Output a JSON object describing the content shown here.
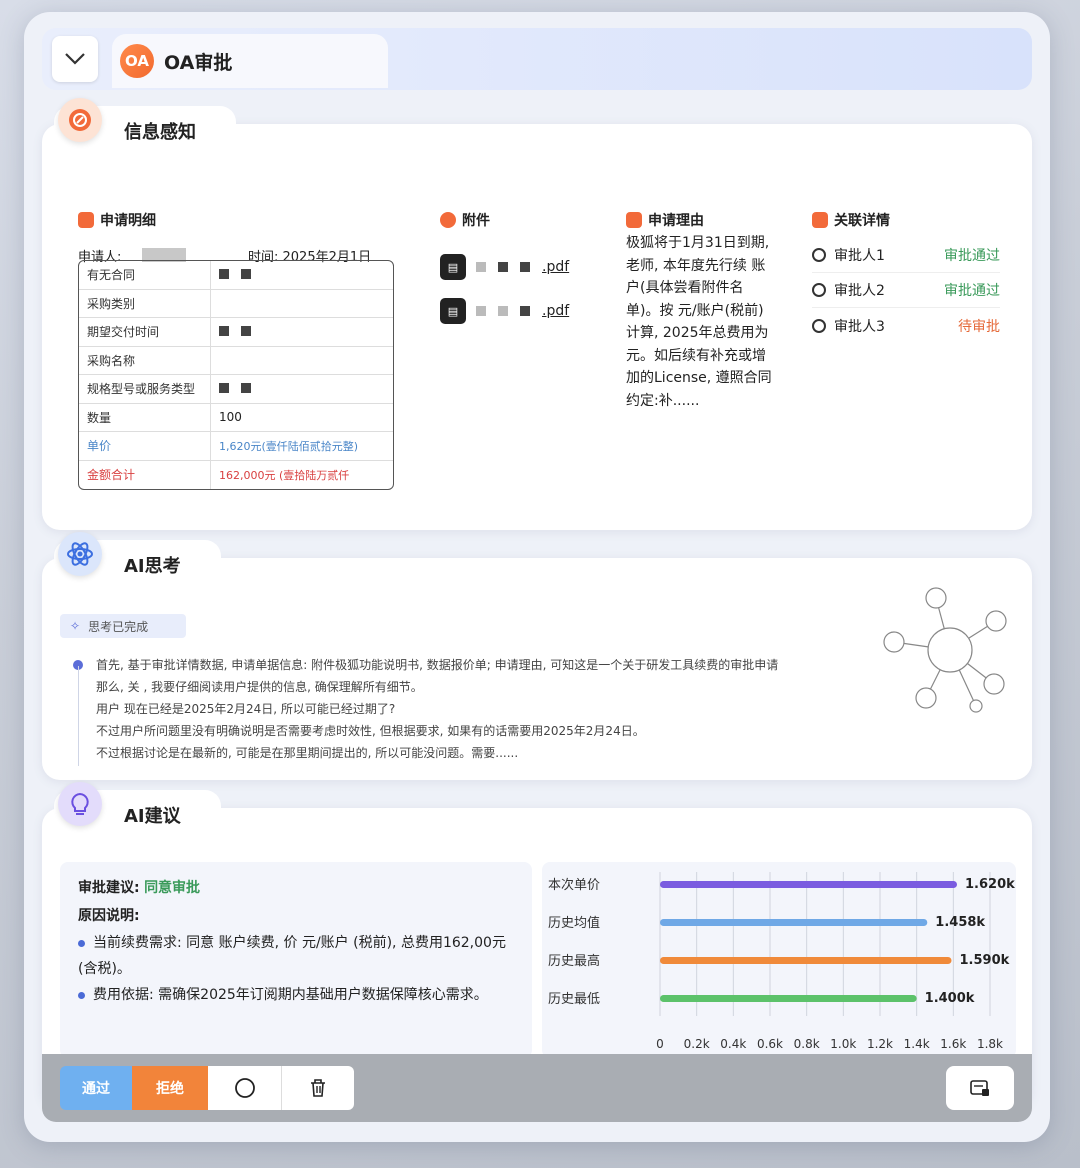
{
  "header": {
    "badge": "OA",
    "title": "OA审批"
  },
  "info": {
    "title": "信息感知",
    "detail": {
      "title": "申请明细",
      "applicant_label": "申请人:",
      "time_label": "时间: 2025年2月1日",
      "rows": [
        {
          "key": "有无合同",
          "val": ""
        },
        {
          "key": "采购类别",
          "val": ""
        },
        {
          "key": "期望交付时间",
          "val": ""
        },
        {
          "key": "采购名称",
          "val": ""
        },
        {
          "key": "规格型号或服务类型",
          "val": ""
        },
        {
          "key": "数量",
          "val": "100"
        },
        {
          "key": "单价",
          "val": "1,620元(壹仟陆佰贰拾元整)"
        },
        {
          "key": "金额合计",
          "val": "162,000元 (壹拾陆万贰仟"
        }
      ]
    },
    "attachments": {
      "title": "附件",
      "files": [
        ".pdf",
        ".pdf"
      ]
    },
    "reason": {
      "title": "申请理由",
      "text": "极狐将于1月31日到期, 老师, 本年度先行续 账户(具体尝看附件名单)。按 元/账户(税前)计算, 2025年总费用为 元。如后续有补充或增加的License, 遵照合同约定:补......"
    },
    "related": {
      "title": "关联详情",
      "approvers": [
        {
          "name": "审批人1",
          "status": "审批通过",
          "color": "#3a9a5a"
        },
        {
          "name": "审批人2",
          "status": "审批通过",
          "color": "#3a9a5a"
        },
        {
          "name": "审批人3",
          "status": "待审批",
          "color": "#e56a3a"
        }
      ]
    }
  },
  "thinking": {
    "title": "AI思考",
    "status": "思考已完成",
    "lines": [
      "首先, 基于审批详情数据, 申请单据信息: 附件极狐功能说明书, 数据报价单; 申请理由, 可知这是一个关于研发工具续费的审批申请",
      "那么, 关 , 我要仔细阅读用户提供的信息, 确保理解所有细节。",
      "用户 现在已经是2025年2月24日, 所以可能已经过期了?",
      "不过用户所问题里没有明确说明是否需要考虑时效性, 但根据要求, 如果有的话需要用2025年2月24日。",
      "不过根据讨论是在最新的, 可能是在那里期间提出的, 所以可能没问题。需要......"
    ]
  },
  "suggestion": {
    "title": "AI建议",
    "verdict_label": "审批建议:",
    "verdict_value": "同意审批",
    "reason_label": "原因说明:",
    "points": [
      "当前续费需求: 同意 账户续费, 价 元/账户 (税前), 总费用162,00元 (含税)。",
      "费用依据: 需确保2025年订阅期内基础用户数据保障核心需求。"
    ]
  },
  "chart_data": {
    "type": "bar",
    "orientation": "horizontal",
    "categories": [
      "本次单价",
      "历史均值",
      "历史最高",
      "历史最低"
    ],
    "values": [
      1620,
      1458,
      1590,
      1400
    ],
    "value_labels": [
      "1.620k",
      "1.458k",
      "1.590k",
      "1.400k"
    ],
    "colors": [
      "#7b5ce0",
      "#6fa8e6",
      "#f08a3a",
      "#5cc26a"
    ],
    "xlim": [
      0,
      1800
    ],
    "ticks": [
      "0",
      "0.2k",
      "0.4k",
      "0.6k",
      "0.8k",
      "1.0k",
      "1.2k",
      "1.4k",
      "1.6k",
      "1.8k"
    ],
    "grid": true
  },
  "actions": {
    "pass": "通过",
    "reject": "拒绝"
  }
}
